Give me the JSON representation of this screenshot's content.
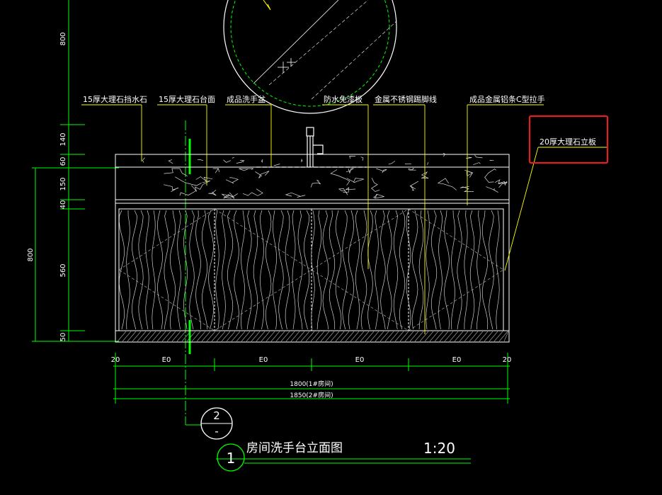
{
  "colors": {
    "background": "#000000",
    "line": "#ffffff",
    "annotation": "#ffff00",
    "dimension": "#00ff00",
    "hatch": "#cfcfcf",
    "highlight": "#e02020"
  },
  "annotations": [
    {
      "id": "a1",
      "text": "15厚大理石挡水石"
    },
    {
      "id": "a2",
      "text": "15厚大理石台面"
    },
    {
      "id": "a3",
      "text": "成品洗手盆"
    },
    {
      "id": "a4",
      "text": "防水免漆板"
    },
    {
      "id": "a5",
      "text": "金属不锈钢踢脚线"
    },
    {
      "id": "a6",
      "text": "成品金属铝条C型拉手"
    },
    {
      "id": "a7",
      "text": "20厚大理石立板"
    }
  ],
  "left_dims": {
    "top": "800",
    "segments": [
      "140",
      "60",
      "150",
      "40",
      "560",
      "50"
    ],
    "total": "800"
  },
  "bottom_dims": {
    "segments": [
      "20",
      "E0",
      "E0",
      "E0",
      "E0",
      "20"
    ],
    "total_1": "1800(1#房间)",
    "total_2": "1850(2#房间)"
  },
  "section_mark": {
    "top": "2",
    "bottom": "-"
  },
  "title": {
    "number": "1",
    "text": "房间洗手台立面图",
    "scale": "1:20"
  }
}
